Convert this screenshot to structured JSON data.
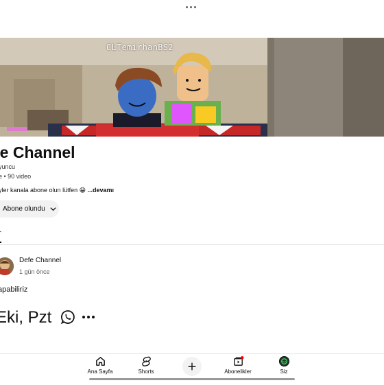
{
  "banner": {
    "overlay_text": "CLTemirhanBS2"
  },
  "channel": {
    "title": "fe Channel",
    "meta_line1": "yuncu",
    "meta_line2": "e • 90 video",
    "description": "yler kanala abone olun lütfen 😁 ",
    "description_more": "...devamı",
    "subscribe_label": "Abone olundu",
    "tab_label": "r"
  },
  "post": {
    "author": "Defe Channel",
    "time": "1 gün önce",
    "text": "apabiliriz",
    "big_text": "Eki, Pzt"
  },
  "nav": {
    "items": [
      {
        "label": "Ana Sayfa",
        "icon": "home-icon"
      },
      {
        "label": "Shorts",
        "icon": "shorts-icon"
      },
      {
        "label": "Abonelikler",
        "icon": "subscriptions-icon"
      },
      {
        "label": "Siz",
        "icon": "profile-icon"
      }
    ],
    "create_icon": "plus-icon"
  },
  "colors": {
    "accent_red": "#ff0000",
    "text": "#0f0f0f",
    "secondary": "#606060"
  }
}
